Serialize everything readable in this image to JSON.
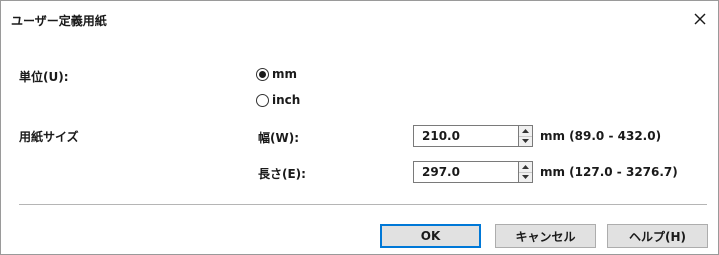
{
  "window": {
    "title": "ユーザー定義用紙",
    "close_label": "×"
  },
  "unit": {
    "label": "単位(U):",
    "options": [
      {
        "label": "mm",
        "selected": true
      },
      {
        "label": "inch",
        "selected": false
      }
    ]
  },
  "paper_size": {
    "label": "用紙サイズ",
    "width": {
      "label": "幅(W):",
      "value": "210.0",
      "range": "mm (89.0 - 432.0)"
    },
    "height": {
      "label": "長さ(E):",
      "value": "297.0",
      "range": "mm (127.0 - 3276.7)"
    }
  },
  "buttons": {
    "ok": "OK",
    "cancel": "キャンセル",
    "help": "ヘルプ(H)"
  },
  "colors": {
    "default_button_border": "#0078d7",
    "button_face": "#e1e1e1"
  }
}
